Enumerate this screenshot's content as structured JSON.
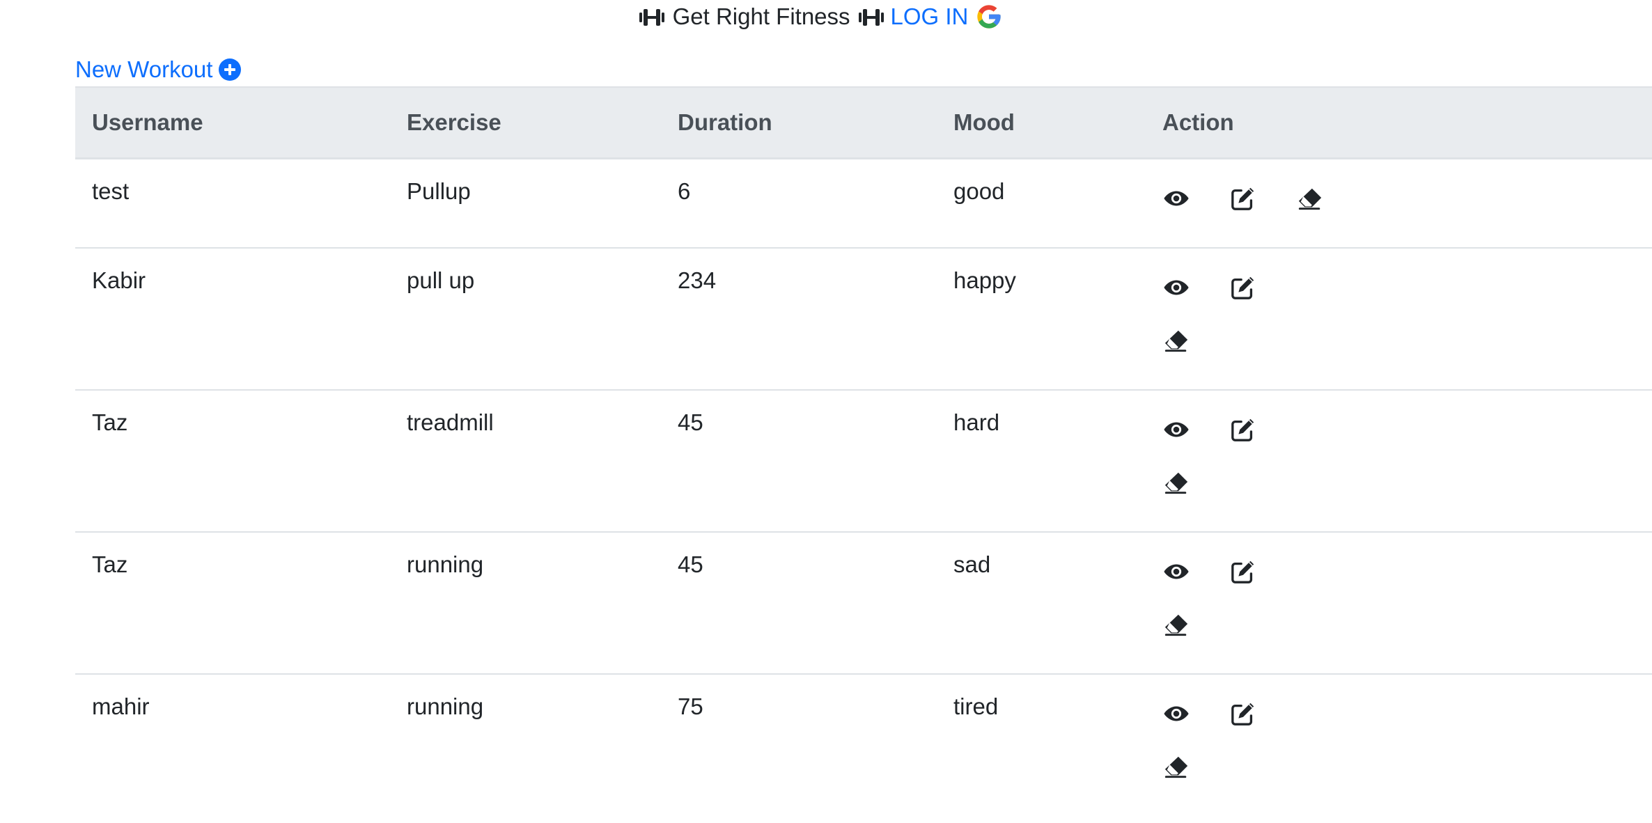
{
  "header": {
    "brand": "Get Right Fitness",
    "login_label": "LOG IN",
    "icons": [
      "dumbbell-icon",
      "dumbbell-icon",
      "google-icon"
    ]
  },
  "toolbar": {
    "new_workout_label": "New Workout",
    "new_workout_icon": "plus-circle-icon"
  },
  "table": {
    "columns": [
      "Username",
      "Exercise",
      "Duration",
      "Mood",
      "Action"
    ],
    "rows": [
      {
        "username": "test",
        "exercise": "Pullup",
        "duration": "6",
        "mood": "good"
      },
      {
        "username": "Kabir",
        "exercise": "pull up",
        "duration": "234",
        "mood": "happy"
      },
      {
        "username": "Taz",
        "exercise": "treadmill",
        "duration": "45",
        "mood": "hard"
      },
      {
        "username": "Taz",
        "exercise": "running",
        "duration": "45",
        "mood": "sad"
      },
      {
        "username": "mahir",
        "exercise": "running",
        "duration": "75",
        "mood": "tired"
      }
    ],
    "action_icons": [
      "eye-icon",
      "edit-icon",
      "eraser-icon"
    ]
  },
  "colors": {
    "link": "#0d6efd",
    "header_bg": "#e9ecef",
    "text": "#212529",
    "google_blue": "#4285F4",
    "google_red": "#EA4335",
    "google_yellow": "#FBBC05",
    "google_green": "#34A853"
  }
}
